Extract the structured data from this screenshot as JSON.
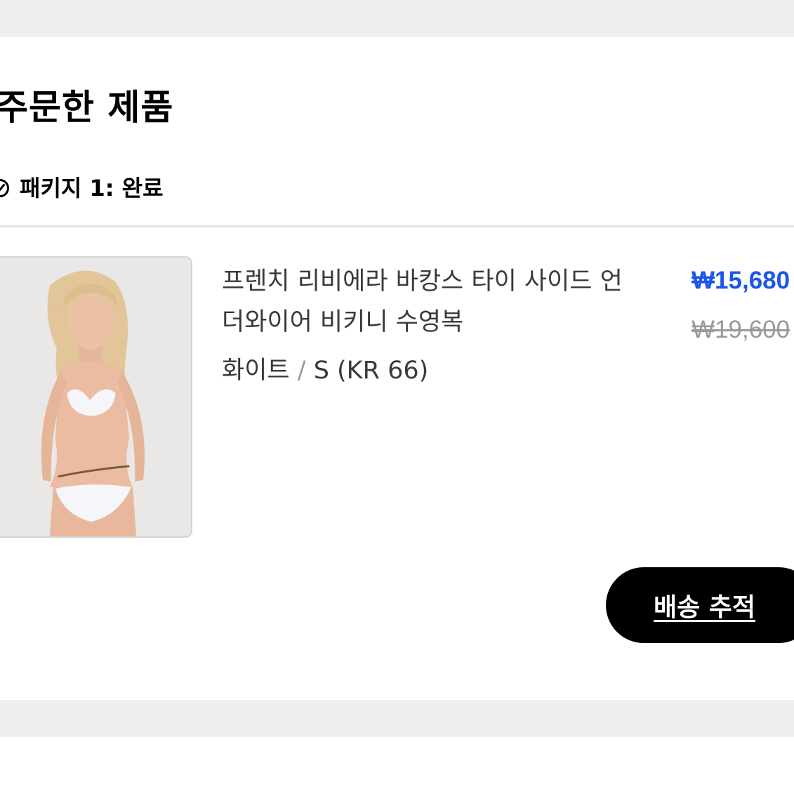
{
  "section": {
    "title": "주문한 제품"
  },
  "package": {
    "label": "패키지 1: 완료",
    "icon": "check-circle-icon"
  },
  "product": {
    "name_lines": [
      "프렌치 리비에라 바캉스 타이 사이드 언",
      "더와이어 비키니 수영복"
    ],
    "color": "화이트",
    "separator": "/",
    "size": "S (KR 66)",
    "sale_price": "₩15,680",
    "original_price": "₩19,600",
    "image": "product-photo"
  },
  "actions": {
    "track_label": "배송 추적"
  },
  "colors": {
    "sale_price": "#1a56e8",
    "button_bg": "#000000",
    "band": "#efefef"
  }
}
